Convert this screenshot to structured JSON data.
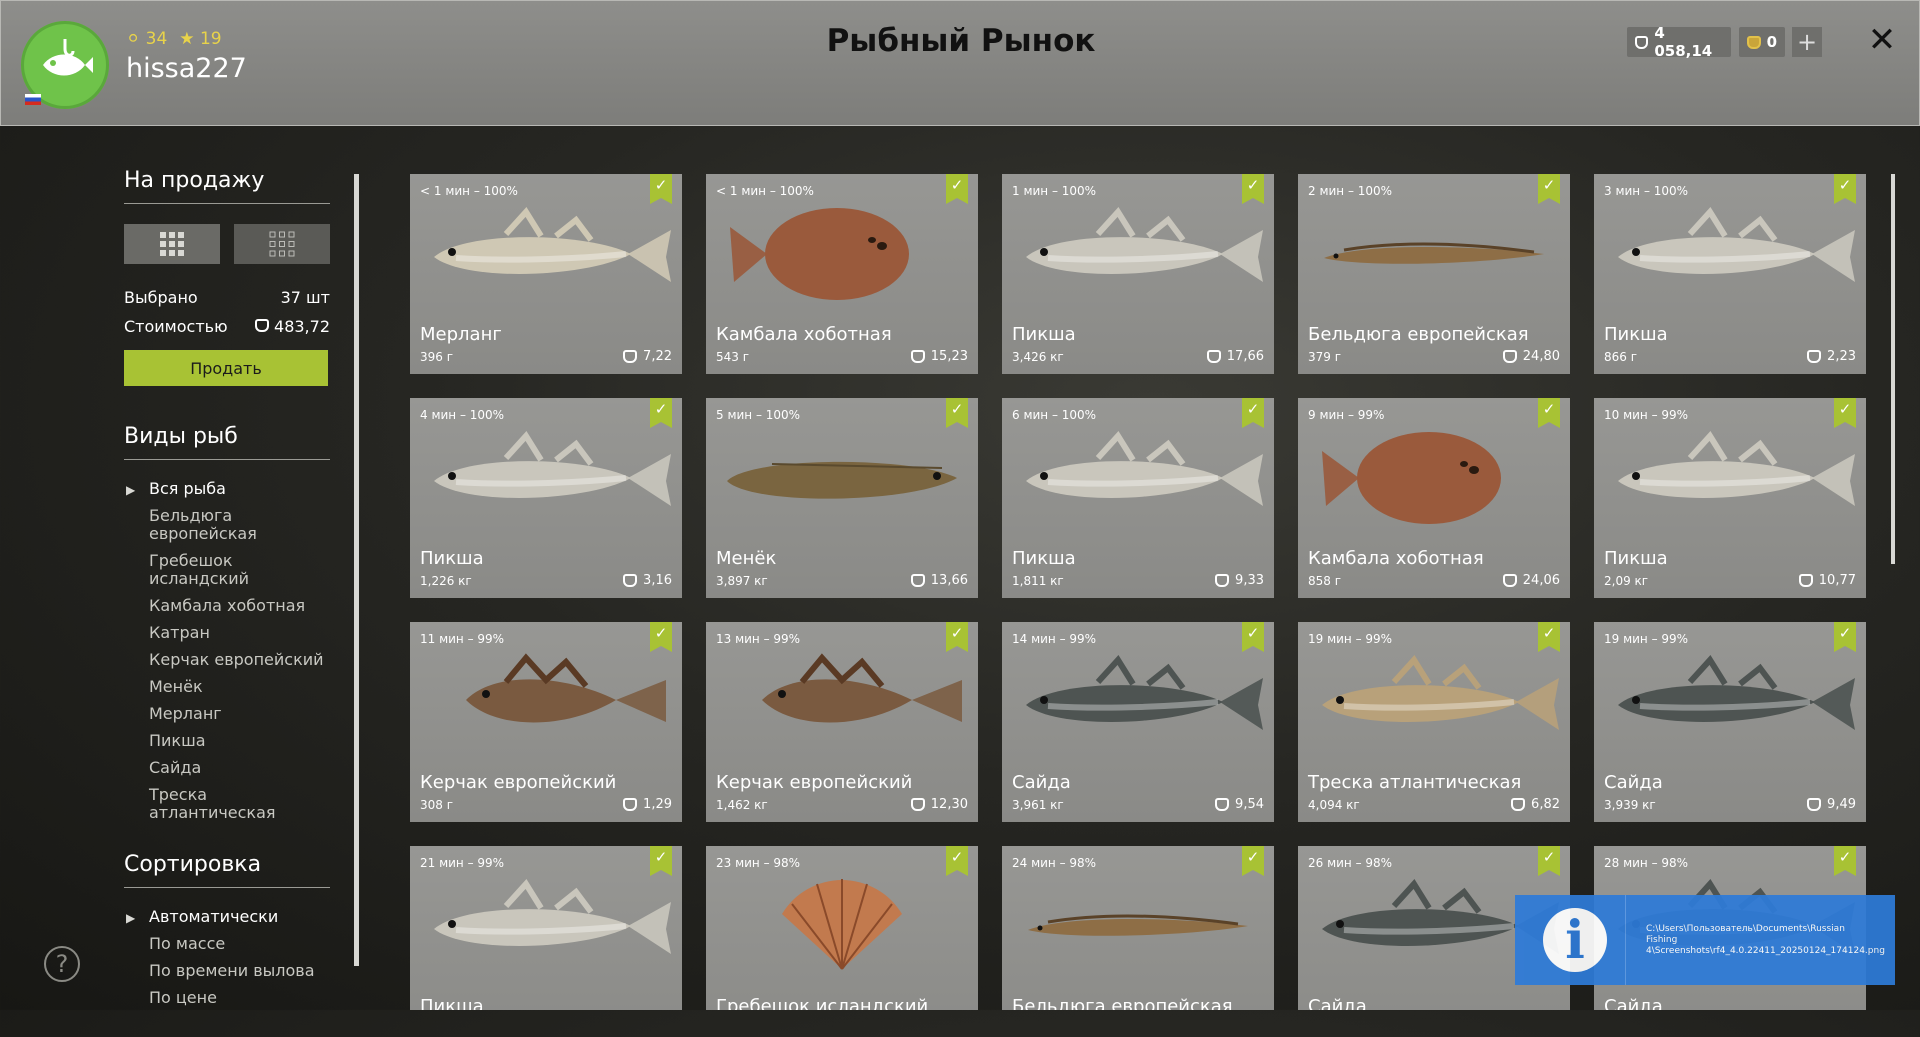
{
  "header": {
    "title": "Рыбный Рынок",
    "username": "hissa227",
    "level": "34",
    "rank": "19",
    "silver": "4 058,14",
    "gold": "0",
    "plus": "+",
    "close": "✕"
  },
  "sidebar": {
    "for_sale_title": "На продажу",
    "selected_label": "Выбрано",
    "selected_value": "37 шт",
    "cost_label": "Стоимостью",
    "cost_value": "483,72",
    "sell_button": "Продать",
    "species_title": "Виды рыб",
    "species": [
      "Вся рыба",
      "Бельдюга европейская",
      "Гребешок исландский",
      "Камбала хоботная",
      "Катран",
      "Керчак европейский",
      "Менёк",
      "Мерланг",
      "Пикша",
      "Сайда",
      "Треска атлантическая"
    ],
    "sort_title": "Сортировка",
    "sort_options": [
      "Автоматически",
      "По массе",
      "По времени вылова",
      "По цене"
    ],
    "help": "?"
  },
  "cards": [
    {
      "time": "< 1 мин – 100%",
      "name": "Мерланг",
      "weight": "396 г",
      "price": "7,22",
      "fish": "merlang"
    },
    {
      "time": "< 1 мин – 100%",
      "name": "Камбала хоботная",
      "weight": "543 г",
      "price": "15,23",
      "fish": "flounder"
    },
    {
      "time": "1 мин – 100%",
      "name": "Пикша",
      "weight": "3,426 кг",
      "price": "17,66",
      "fish": "haddock"
    },
    {
      "time": "2 мин – 100%",
      "name": "Бельдюга европейская",
      "weight": "379 г",
      "price": "24,80",
      "fish": "eelpout"
    },
    {
      "time": "3 мин – 100%",
      "name": "Пикша",
      "weight": "866 г",
      "price": "2,23",
      "fish": "haddock"
    },
    {
      "time": "4 мин – 100%",
      "name": "Пикша",
      "weight": "1,226 кг",
      "price": "3,16",
      "fish": "haddock"
    },
    {
      "time": "5 мин – 100%",
      "name": "Менёк",
      "weight": "3,897 кг",
      "price": "13,66",
      "fish": "tusk"
    },
    {
      "time": "6 мин – 100%",
      "name": "Пикша",
      "weight": "1,811 кг",
      "price": "9,33",
      "fish": "haddock"
    },
    {
      "time": "9 мин – 99%",
      "name": "Камбала хоботная",
      "weight": "858 г",
      "price": "24,06",
      "fish": "flounder"
    },
    {
      "time": "10 мин – 99%",
      "name": "Пикша",
      "weight": "2,09 кг",
      "price": "10,77",
      "fish": "haddock"
    },
    {
      "time": "11 мин – 99%",
      "name": "Керчак европейский",
      "weight": "308 г",
      "price": "1,29",
      "fish": "sculpin"
    },
    {
      "time": "13 мин – 99%",
      "name": "Керчак европейский",
      "weight": "1,462 кг",
      "price": "12,30",
      "fish": "sculpin"
    },
    {
      "time": "14 мин – 99%",
      "name": "Сайда",
      "weight": "3,961 кг",
      "price": "9,54",
      "fish": "pollock"
    },
    {
      "time": "19 мин – 99%",
      "name": "Треска атлантическая",
      "weight": "4,094 кг",
      "price": "6,82",
      "fish": "cod"
    },
    {
      "time": "19 мин – 99%",
      "name": "Сайда",
      "weight": "3,939 кг",
      "price": "9,49",
      "fish": "pollock"
    },
    {
      "time": "21 мин – 99%",
      "name": "Пикша",
      "weight": "",
      "price": "",
      "fish": "haddock"
    },
    {
      "time": "23 мин – 98%",
      "name": "Гребешок исландский",
      "weight": "",
      "price": "",
      "fish": "scallop"
    },
    {
      "time": "24 мин – 98%",
      "name": "Бельдюга европейская",
      "weight": "",
      "price": "",
      "fish": "eelpout"
    },
    {
      "time": "26 мин – 98%",
      "name": "Сайда",
      "weight": "",
      "price": "",
      "fish": "pollock"
    },
    {
      "time": "28 мин – 98%",
      "name": "Сайда",
      "weight": "",
      "price": "",
      "fish": "pollock"
    }
  ],
  "fish_colors": {
    "merlang": "#cfc8b4",
    "flounder": "#9a5a3c",
    "haddock": "#c9c6bc",
    "eelpout": "#8e6e46",
    "tusk": "#7a6540",
    "sculpin": "#7a5a40",
    "pollock": "#4e5452",
    "cod": "#b8a17a",
    "scallop": "#c27a4e"
  },
  "notification": {
    "icon": "i",
    "text": "C:\\Users\\Пользователь\\Documents\\Russian Fishing 4\\Screenshots\\rf4_4.0.22411_20250124_174124.png"
  }
}
